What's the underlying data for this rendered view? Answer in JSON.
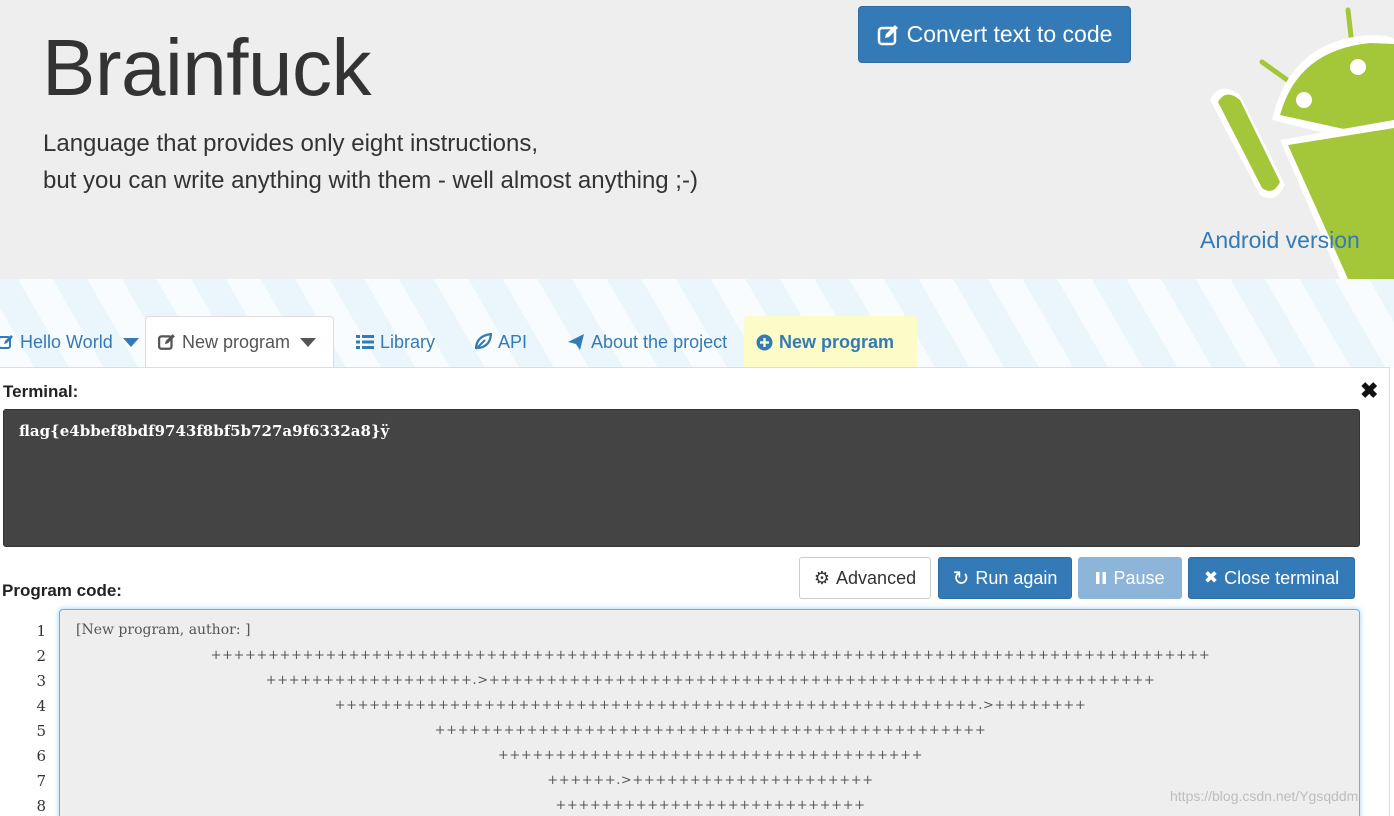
{
  "header": {
    "title": "Brainfuck",
    "subtitle_line1": "Language that provides only eight instructions,",
    "subtitle_line2": "but you can write anything with them - well almost anything ;-)",
    "convert_button": "Convert text to code",
    "android_link": "Android version"
  },
  "nav": {
    "tabs": [
      {
        "label": "Hello World",
        "icon": "pencil-square-icon",
        "dropdown": true
      },
      {
        "label": "New program",
        "icon": "edit-icon",
        "dropdown": true,
        "active": true
      },
      {
        "label": "Library",
        "icon": "list-icon"
      },
      {
        "label": "API",
        "icon": "leaf-icon"
      },
      {
        "label": "About the project",
        "icon": "send-icon"
      },
      {
        "label": "New program",
        "icon": "plus-circle-icon",
        "highlight": true
      }
    ]
  },
  "terminal": {
    "label": "Terminal:",
    "output": "flag{e4bbef8bdf9743f8bf5b727a9f6332a8}ÿ"
  },
  "buttons": {
    "advanced": "Advanced",
    "run_again": "Run again",
    "pause": "Pause",
    "close_terminal": "Close terminal"
  },
  "program": {
    "label": "Program code:",
    "line_numbers": [
      "1",
      "2",
      "3",
      "4",
      "5",
      "6",
      "7",
      "8"
    ],
    "lines": [
      "[New program, author: ]",
      "+++++++++++++++++++++++++++++++++++++++++++++++++++++++++++++++++++++++++++++++++++++++",
      "++++++++++++++++++.>++++++++++++++++++++++++++++++++++++++++++++++++++++++++++",
      "++++++++++++++++++++++++++++++++++++++++++++++++++++++++.>++++++++",
      "++++++++++++++++++++++++++++++++++++++++++++++++",
      "+++++++++++++++++++++++++++++++++++++",
      "++++++.>+++++++++++++++++++++",
      "+++++++++++++++++++++++++++"
    ]
  },
  "watermark": "https://blog.csdn.net/Ygsqddm",
  "colors": {
    "primary": "#337ab7",
    "terminal_bg": "#444444",
    "header_bg": "#eeeeee",
    "android_green": "#a4c639",
    "highlight_tab": "#fcfcc8"
  }
}
